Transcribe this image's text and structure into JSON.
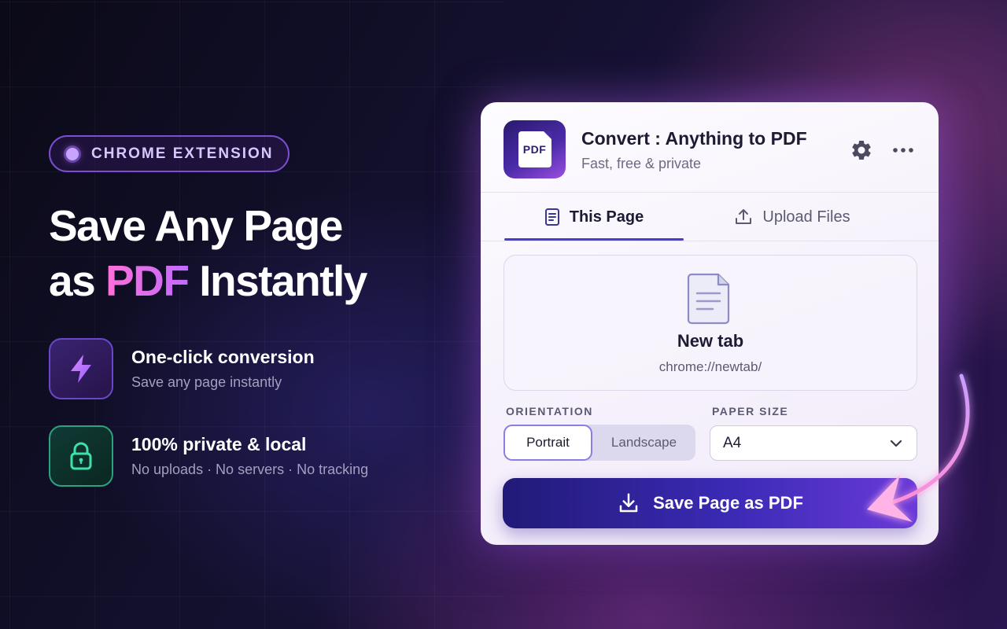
{
  "marketing": {
    "badge_label": "CHROME EXTENSION",
    "headline_line1": "Save Any Page",
    "headline_as": "as",
    "headline_accent": "PDF",
    "headline_rest": "Instantly",
    "features": [
      {
        "title": "One-click conversion",
        "subtitle": "Save any page instantly",
        "icon": "lightning-icon"
      },
      {
        "title": "100% private & local",
        "subtitle": "No uploads · No servers · No tracking",
        "icon": "lock-icon"
      }
    ]
  },
  "popup": {
    "logo_text": "PDF",
    "title": "Convert : Anything to PDF",
    "subtitle": "Fast, free & private",
    "header_icons": [
      "gear-icon",
      "more-icon"
    ],
    "tabs": [
      {
        "label": "This Page",
        "icon": "document-icon",
        "active": true
      },
      {
        "label": "Upload Files",
        "icon": "upload-icon",
        "active": false
      }
    ],
    "page_card": {
      "title": "New tab",
      "url": "chrome://newtab/"
    },
    "orientation": {
      "label": "ORIENTATION",
      "options": [
        "Portrait",
        "Landscape"
      ],
      "selected": "Portrait"
    },
    "paper_size": {
      "label": "PAPER SIZE",
      "value": "A4"
    },
    "save_button": "Save Page as PDF"
  },
  "colors": {
    "accent": "#4b3bd6",
    "pdf_gradient_start": "#ff6fd8",
    "pdf_gradient_end": "#c16bff",
    "button_start": "#211a78",
    "button_end": "#6a3ad8"
  }
}
